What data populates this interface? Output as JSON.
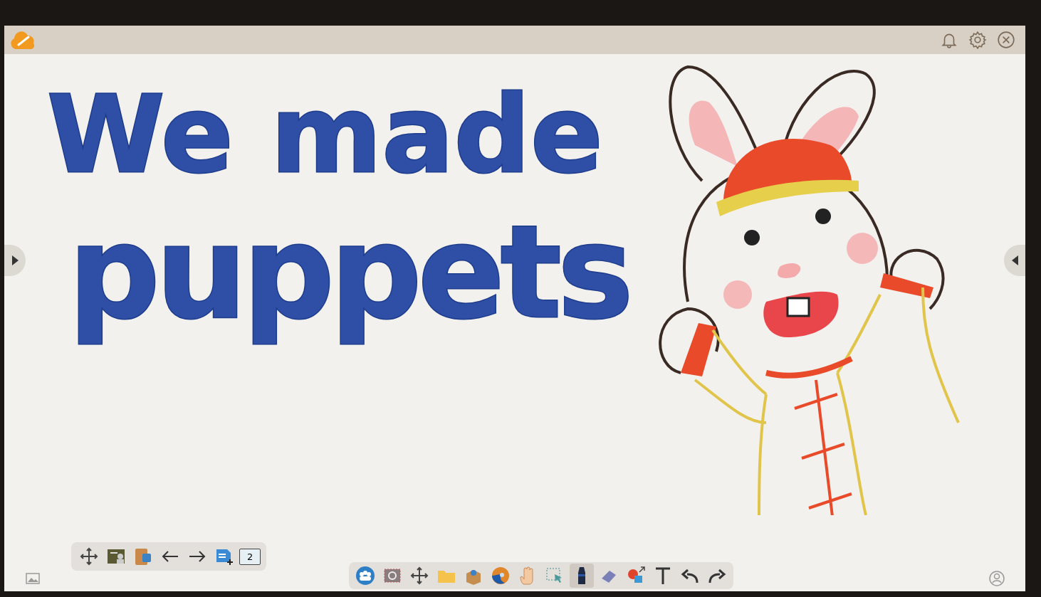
{
  "canvas": {
    "ink_lines": [
      {
        "text": "We made"
      },
      {
        "text": "puppets"
      }
    ]
  },
  "page_toolbar": {
    "tools": [
      {
        "kind": "move"
      },
      {
        "kind": "board"
      },
      {
        "kind": "clipboard"
      },
      {
        "kind": "back"
      },
      {
        "kind": "forward"
      },
      {
        "kind": "add-page"
      }
    ],
    "page_number": "2"
  },
  "main_toolbar": {
    "tools": [
      {
        "kind": "people",
        "selected": false
      },
      {
        "kind": "screenshot",
        "selected": false
      },
      {
        "kind": "move",
        "selected": false
      },
      {
        "kind": "folder",
        "selected": false
      },
      {
        "kind": "box",
        "selected": false
      },
      {
        "kind": "browser",
        "selected": false
      },
      {
        "kind": "hand",
        "selected": false
      },
      {
        "kind": "select",
        "selected": false
      },
      {
        "kind": "pen",
        "selected": true
      },
      {
        "kind": "eraser",
        "selected": false
      },
      {
        "kind": "shapes",
        "selected": false
      },
      {
        "kind": "text",
        "selected": false
      },
      {
        "kind": "undo",
        "selected": false
      },
      {
        "kind": "redo",
        "selected": false
      }
    ]
  }
}
